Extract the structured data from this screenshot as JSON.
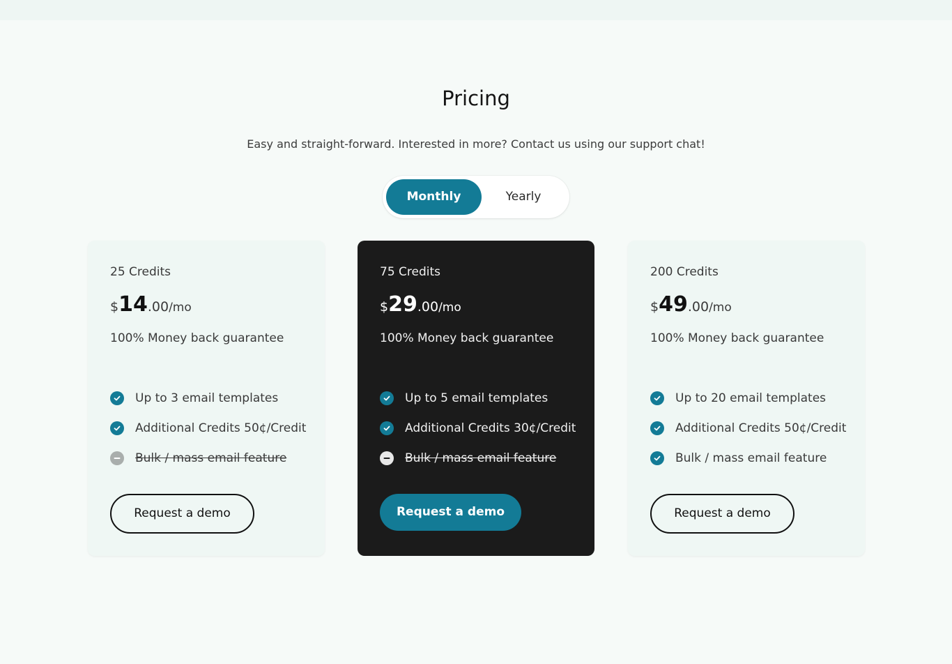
{
  "header": {
    "title": "Pricing",
    "subtitle": "Easy and straight-forward. Interested in more? Contact us using our support chat!"
  },
  "billing_toggle": {
    "options": [
      "Monthly",
      "Yearly"
    ],
    "selected": "Monthly"
  },
  "colors": {
    "accent": "#137b96",
    "dark_card": "#1b1b1b",
    "light_card": "#eff7f4",
    "page_bg": "#f6faf8"
  },
  "plans": [
    {
      "credits": "25 Credits",
      "currency": "$",
      "price_whole": "14",
      "price_cents": ".00",
      "period": "/mo",
      "guarantee": "100% Money back guarantee",
      "features": [
        {
          "text": "Up to 3 email templates",
          "included": true,
          "icon": "check-circle-icon"
        },
        {
          "text": "Additional Credits 50¢/Credit",
          "included": true,
          "icon": "check-circle-icon"
        },
        {
          "text": "Bulk / mass email feature",
          "included": false,
          "icon": "minus-circle-icon"
        }
      ],
      "cta": "Request a demo",
      "highlighted": false
    },
    {
      "credits": "75 Credits",
      "currency": "$",
      "price_whole": "29",
      "price_cents": ".00",
      "period": "/mo",
      "guarantee": "100% Money back guarantee",
      "features": [
        {
          "text": "Up to 5 email templates",
          "included": true,
          "icon": "check-circle-icon"
        },
        {
          "text": "Additional Credits 30¢/Credit",
          "included": true,
          "icon": "check-circle-icon"
        },
        {
          "text": "Bulk / mass email feature",
          "included": false,
          "icon": "minus-circle-icon"
        }
      ],
      "cta": "Request a demo",
      "highlighted": true
    },
    {
      "credits": "200 Credits",
      "currency": "$",
      "price_whole": "49",
      "price_cents": ".00",
      "period": "/mo",
      "guarantee": "100% Money back guarantee",
      "features": [
        {
          "text": "Up to 20 email templates",
          "included": true,
          "icon": "check-circle-icon"
        },
        {
          "text": "Additional Credits 50¢/Credit",
          "included": true,
          "icon": "check-circle-icon"
        },
        {
          "text": "Bulk / mass email feature",
          "included": true,
          "icon": "check-circle-icon"
        }
      ],
      "cta": "Request a demo",
      "highlighted": false
    }
  ]
}
